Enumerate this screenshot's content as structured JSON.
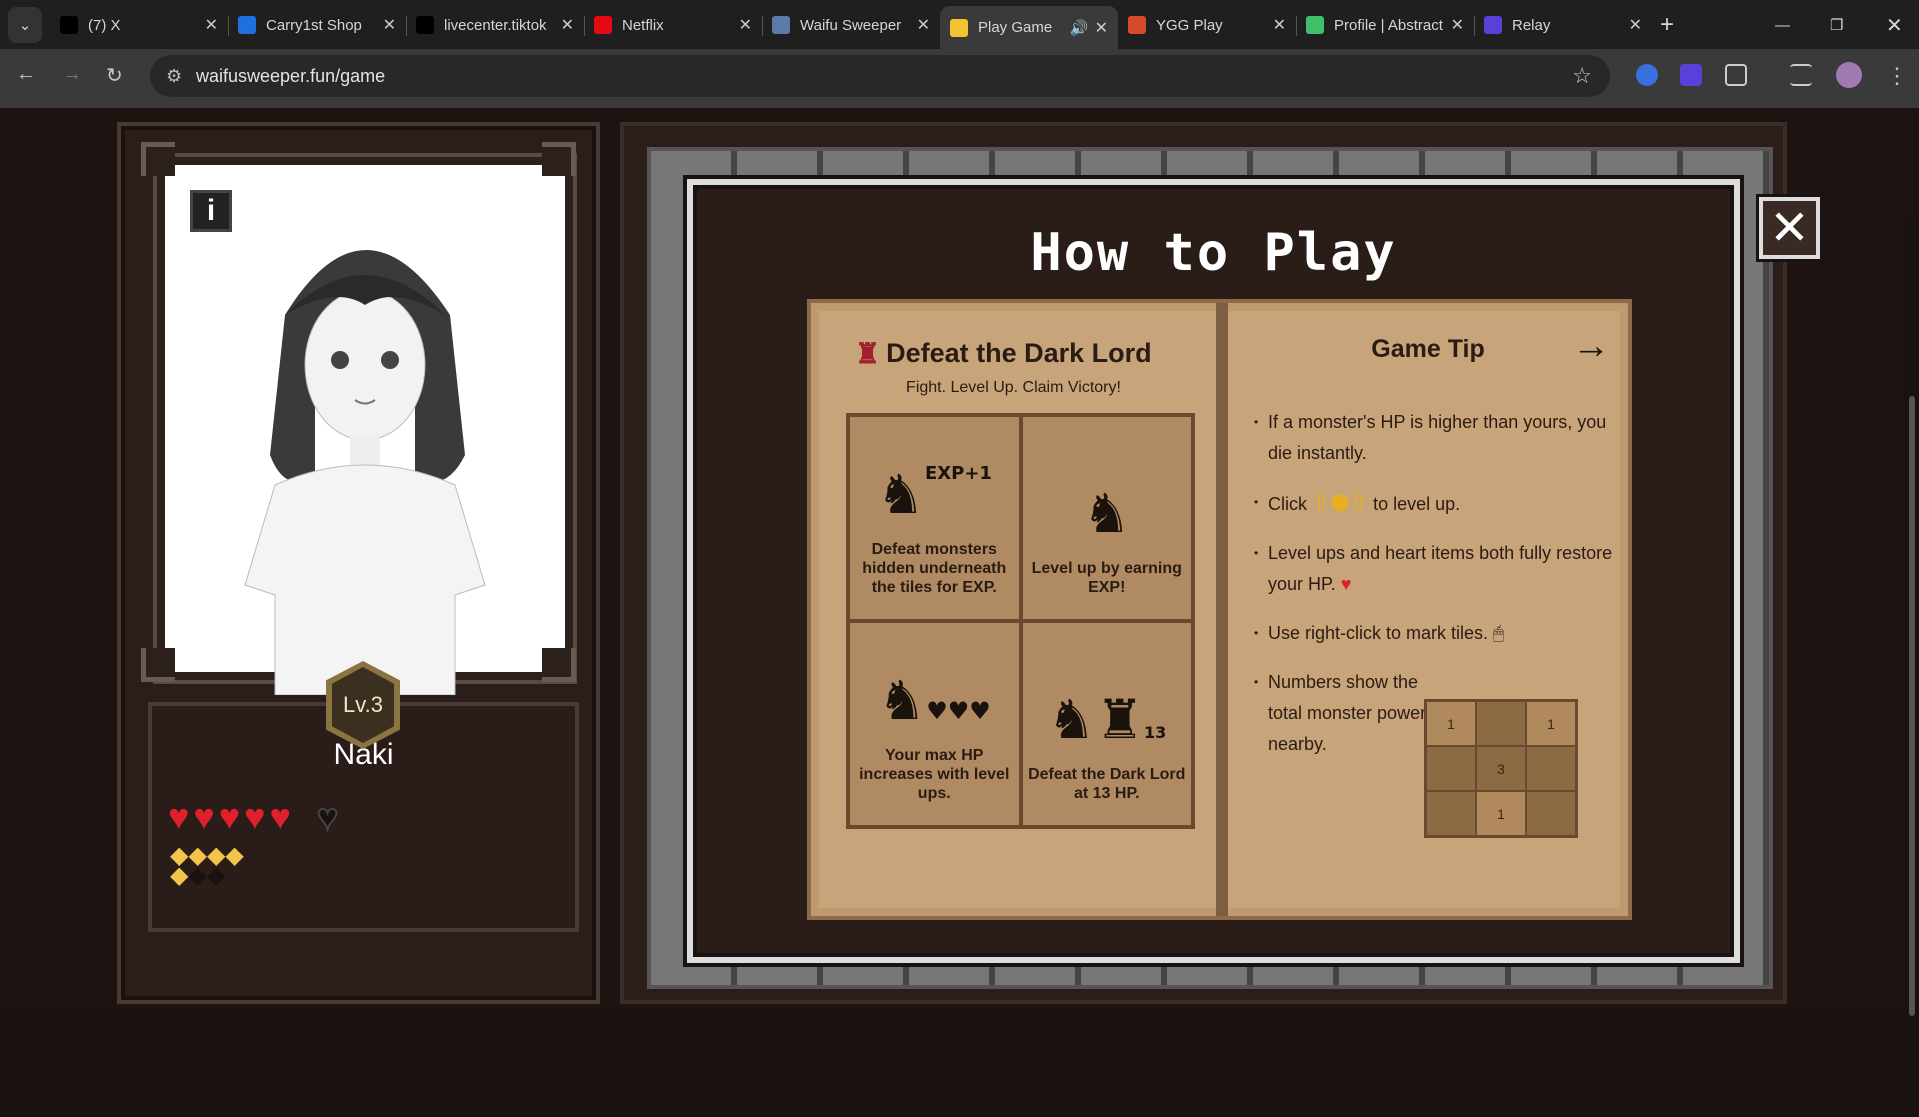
{
  "browser": {
    "tabs": [
      {
        "title": "(7) X",
        "icon": "x-logo",
        "color": "#000000"
      },
      {
        "title": "Carry1st Shop",
        "icon": "carry1st-logo",
        "color": "#1e6fe0"
      },
      {
        "title": "livecenter.tiktok",
        "icon": "tiktok-logo",
        "color": "#000000"
      },
      {
        "title": "Netflix",
        "icon": "netflix-logo",
        "color": "#e50914"
      },
      {
        "title": "Waifu Sweeper",
        "icon": "waifu-logo",
        "color": "#5a7aa8"
      },
      {
        "title": "Play Game",
        "icon": "crown-icon",
        "color": "#f2c230",
        "active": true
      },
      {
        "title": "YGG Play",
        "icon": "ygg-logo",
        "color": "#d84a2a"
      },
      {
        "title": "Profile | Abstract",
        "icon": "abstract-logo",
        "color": "#3fbf6a"
      },
      {
        "title": "Relay",
        "icon": "relay-logo",
        "color": "#5a3fd8"
      }
    ],
    "url": "waifusweeper.fun/game"
  },
  "character": {
    "name": "Naki",
    "level": "Lv.3",
    "hp_current": 5,
    "hp_max": 6,
    "exp_filled": 5,
    "exp_total": 7
  },
  "modal": {
    "title": "How to Play",
    "close": "✕",
    "left_page": {
      "heading": "Defeat the Dark Lord",
      "subtitle": "Fight. Level Up. Claim Victory!",
      "cells": [
        {
          "caption": "Defeat monsters hidden underneath the tiles for EXP.",
          "badge": "EXP+1"
        },
        {
          "caption": "Level up by earning EXP!"
        },
        {
          "caption": "Your max HP increases with level ups."
        },
        {
          "caption": "Defeat the Dark Lord at 13 HP.",
          "badge": "13"
        }
      ]
    },
    "right_page": {
      "heading": "Game Tip",
      "tips": [
        "If a monster's HP is higher than yours, you die instantly.",
        "Click",
        "to level up.",
        "Level ups and heart items both fully restore your HP.",
        "Use right-click to mark tiles.",
        "Numbers show the total monster power nearby."
      ],
      "example_grid": [
        "1",
        "",
        "1",
        "",
        "3",
        "",
        "",
        "1",
        ""
      ]
    }
  }
}
